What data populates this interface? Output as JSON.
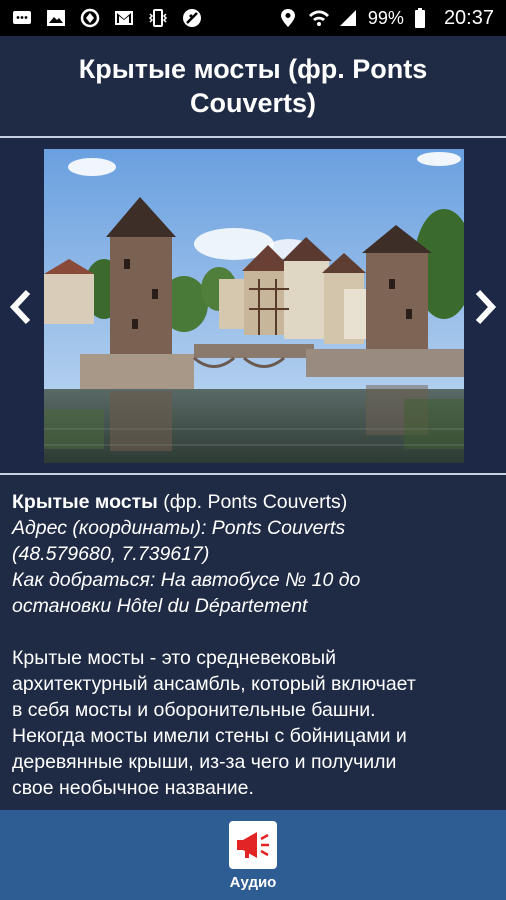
{
  "status_bar": {
    "icons_left": [
      "messages-icon",
      "gallery-icon",
      "sync-icon",
      "gmail-icon",
      "vibrate-icon",
      "blocked-icon"
    ],
    "icons_right": [
      "location-icon",
      "wifi-icon",
      "signal-icon"
    ],
    "battery": "99%",
    "time": "20:37"
  },
  "header": {
    "title": "Крытые мосты (фр. Ponts Couverts)"
  },
  "gallery": {
    "image": "photo-covered-bridges",
    "prev_icon": "chevron-left-icon",
    "next_icon": "chevron-right-icon"
  },
  "details": {
    "name_bold": "Крытые мосты",
    "name_rest": " (фр. Ponts Couverts)",
    "address_line1": "Адрес (координаты): Ponts Couverts",
    "address_line2": "(48.579680, 7.739617)",
    "route_line1": "Как добраться: На автобусе № 10 до",
    "route_line2": "остановки Hôtel du Département",
    "description": [
      "Крытые мосты - это средневековый",
      "архитектурный ансамбль, который включает",
      "в себя мосты и оборонительные башни.",
      "Некогда мосты имели стены с бойницами и",
      "деревянные крыши, из-за чего и получили",
      "свое необычное название."
    ]
  },
  "bottom_bar": {
    "audio_label": "Аудио",
    "audio_icon": "megaphone-icon"
  },
  "colors": {
    "background": "#1f2a44",
    "bottom_bar": "#2d5d93",
    "audio_icon": "#e32424"
  }
}
